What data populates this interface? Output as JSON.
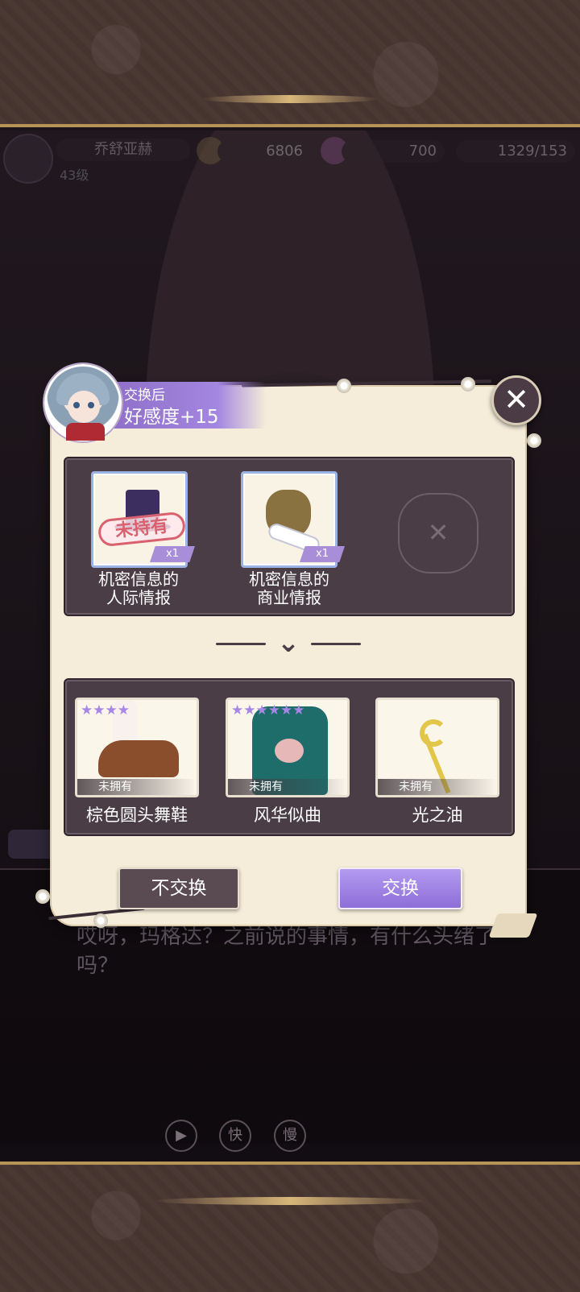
{
  "hud": {
    "player_name": "乔舒亚赫",
    "level": "43级",
    "gold": "6806",
    "diamonds": "700",
    "stamina": "1329/153"
  },
  "dialogue": {
    "text": "哎呀，玛格达？之前说的事情，有什么头绪了吗？"
  },
  "playback_controls": [
    "▶",
    "快",
    "慢"
  ],
  "exchange_dialog": {
    "affinity_label": "交换后",
    "affinity_value": "好感度+15",
    "close_icon": "✕",
    "given_items": [
      {
        "name": "机密信息的人际情报",
        "name_line1": "机密信息的",
        "name_line2": "人际情报",
        "qty": "x1",
        "stamp": "未持有",
        "icon": "top-hat-icon"
      },
      {
        "name": "机密信息的商业情报",
        "name_line1": "机密信息的",
        "name_line2": "商业情报",
        "qty": "x1",
        "icon": "sack-scroll-icon"
      }
    ],
    "empty_slot_icon": "crossed-swords-icon",
    "rewards": [
      {
        "name": "棕色圆头舞鞋",
        "status": "未拥有",
        "stars": 4,
        "icon": "shoes-icon"
      },
      {
        "name": "风华似曲",
        "status": "未拥有",
        "stars": 6,
        "icon": "dress-icon"
      },
      {
        "name": "光之油",
        "status": "未拥有",
        "stars": 0,
        "icon": "moon-wand-icon"
      }
    ],
    "buttons": {
      "decline": "不交换",
      "accept": "交换"
    }
  },
  "colors": {
    "accent_purple": "#a386e0",
    "panel": "#4a3d45",
    "parchment": "#f5ecd9",
    "gold_trim": "#b89358"
  }
}
